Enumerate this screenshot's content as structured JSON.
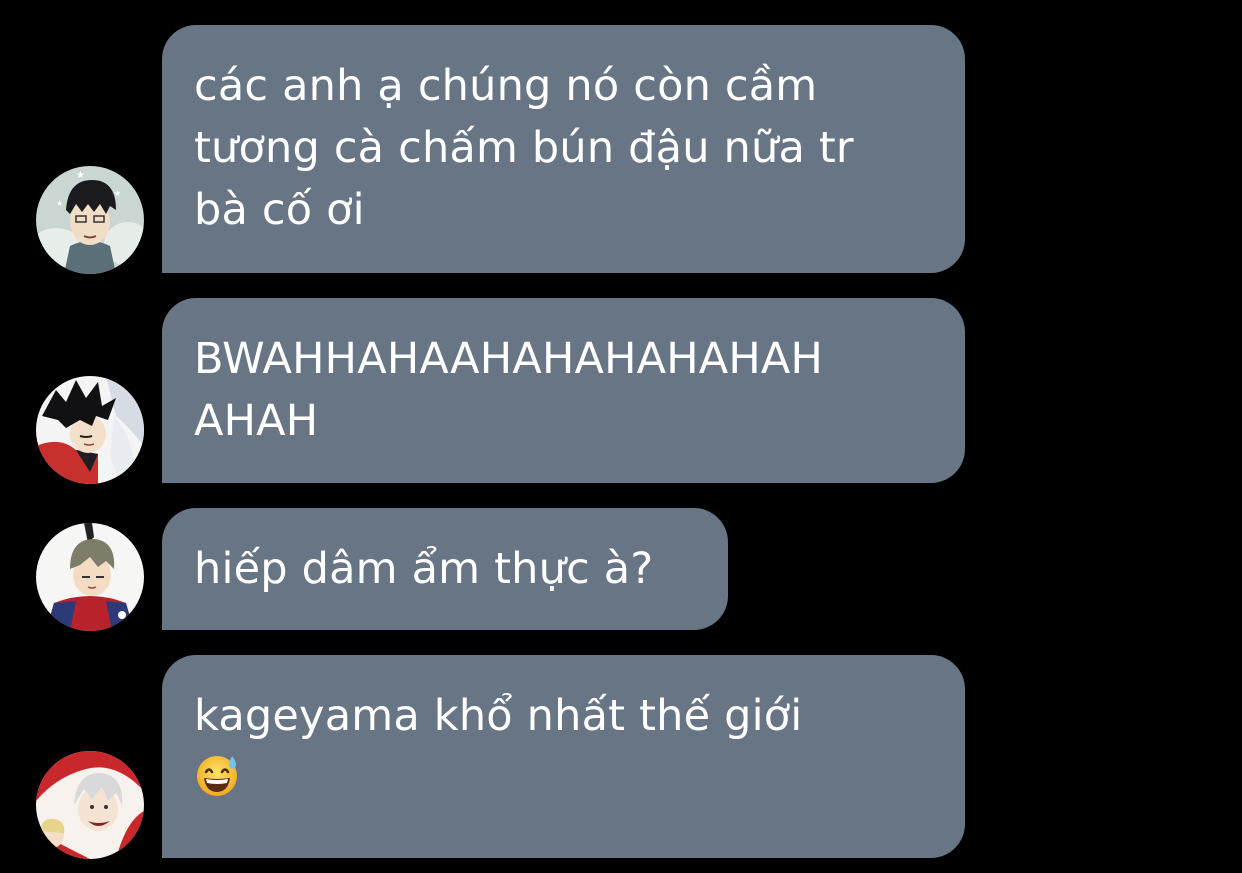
{
  "messages": [
    {
      "avatar": "avatar-dark-hair-character",
      "lines": [
        "các anh ạ chúng nó còn cầm",
        "tương cà chấm bún đậu nữa tr",
        "bà cố ơi"
      ]
    },
    {
      "avatar": "avatar-black-messy-hair-character",
      "lines": [
        "BWAHHAHAAHAHAHAHAHAH",
        "AHAH"
      ]
    },
    {
      "avatar": "avatar-grey-hair-character",
      "lines": [
        "hiếp dâm ẩm thực à?"
      ]
    },
    {
      "avatar": "avatar-silver-hair-character",
      "lines": [
        "kageyama khổ nhất thế giới"
      ],
      "emoji": "grinning-sweat-emoji"
    }
  ],
  "colors": {
    "background": "#000000",
    "bubble": "#687585",
    "text": "#ffffff"
  }
}
